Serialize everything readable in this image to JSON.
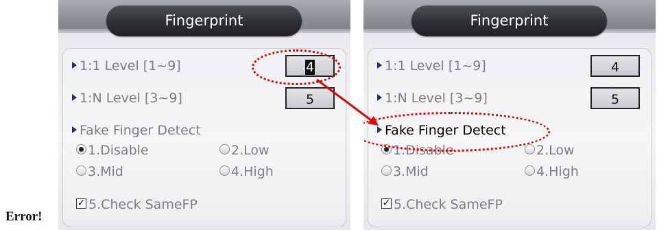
{
  "error_text": "Error!",
  "left": {
    "title": "Fingerprint",
    "level_1_1_label": "1:1 Level [1~9]",
    "level_1_1_value": "4",
    "level_1_n_label": "1:N Level [3~9]",
    "level_1_n_value": "5",
    "fake_label": "Fake Finger Detect",
    "options": [
      "1.Disable",
      "2.Low",
      "3.Mid",
      "4.High"
    ],
    "selected_option": "1.Disable",
    "check_label": "5.Check SameFP",
    "check_mark": "✓"
  },
  "right": {
    "title": "Fingerprint",
    "level_1_1_label": "1:1 Level [1~9]",
    "level_1_1_value": "4",
    "level_1_n_label": "1:N Level [3~9]",
    "level_1_n_value": "5",
    "fake_label": "Fake Finger Detect",
    "options": [
      "1.Disable",
      "2.Low",
      "3.Mid",
      "4.High"
    ],
    "selected_option": "1.Disable",
    "check_label": "5.Check SameFP",
    "check_mark": "✓"
  },
  "annotation_color": "#e00000"
}
